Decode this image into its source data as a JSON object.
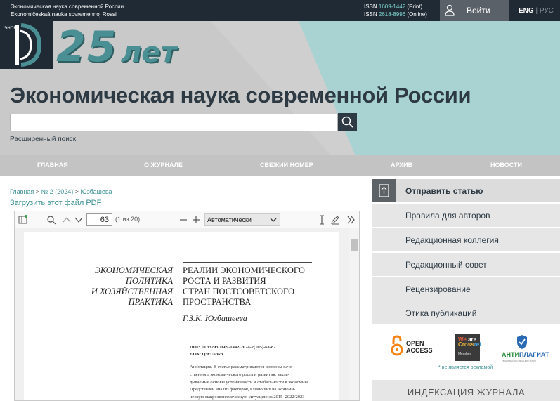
{
  "topbar": {
    "journal_ru": "Экономическая наука современной России",
    "journal_lat": "Ekonomičeskaâ nauka sovremennoj Rossii",
    "issn_print_label": "ISSN",
    "issn_print": "1609-1442",
    "issn_print_suffix": "(Print)",
    "issn_online_label": "ISSN",
    "issn_online": "2618-8996",
    "issn_online_suffix": "(Online)",
    "login_label": "Войти",
    "lang_eng": "ENG",
    "lang_sep": "|",
    "lang_rus": "РУС"
  },
  "hero": {
    "anniversary_number": "25",
    "anniversary_word": "лет",
    "title": "Экономическая наука современной России",
    "search_placeholder": "",
    "advanced_search": "Расширенный поиск",
    "colors": {
      "teal": "#a8d3d2",
      "gray": "#c9c9c9",
      "dark": "#1f2a34"
    }
  },
  "nav": {
    "items": [
      "Главная",
      "О журнале",
      "Свежий номер",
      "Архив",
      "Новости"
    ]
  },
  "breadcrumb": {
    "home": "Главная",
    "sep1": ">",
    "issue": "№ 2 (2024)",
    "sep2": ">",
    "current": "Юзбашева"
  },
  "download_link": "Загрузить этот файл PDF",
  "pdf_viewer": {
    "page_number": "63",
    "page_of": "(1 из 20)",
    "zoom": "Автоматически",
    "document": {
      "section": [
        "ЭКОНОМИЧЕСКАЯ",
        "ПОЛИТИКА",
        "И ХОЗЯЙСТВЕННАЯ",
        "ПРАКТИКА"
      ],
      "title": [
        "РЕАЛИИ ЭКОНОМИЧЕСКОГО",
        "РОСТА И РАЗВИТИЯ",
        "СТРАН ПОСТСОВЕТСКОГО",
        "ПРОСТРАНСТВА"
      ],
      "author": "Г.З.К. Юзбашеева",
      "doi": "DOI: 10.33293/1609-1442-2024-2(105)-63-82",
      "edn": "EDN: QWUFWY",
      "abstract_lines": [
        "Аннотация. В статье рассматриваются вопросы каче-",
        "ственного экономического роста и развития, закла-",
        "дываемые основы устойчивости и стабильности в экономике.",
        "Представлен анализ факторов, влияющих на экономи-",
        "ческую макроэкономическую ситуацию за 2015–2022/2023"
      ]
    }
  },
  "sidebar": {
    "items": [
      "Отправить статью",
      "Правила для авторов",
      "Редакционная коллегия",
      "Редакционный совет",
      "Рецензирование",
      "Этика публикаций"
    ],
    "logos": {
      "open_access": [
        "OPEN",
        "ACCESS"
      ],
      "crossref_top": [
        "We",
        "are",
        "Cross",
        "ref"
      ],
      "crossref_member": "Member",
      "antiplagiat_a": "АНТИ",
      "antiplagiat_b": "ПЛАГИАТ",
      "antiplagiat_sub": "ТВОРИТЕ СОБСТВЕННЫМ УМОМ",
      "ad_note": "* не является рекламой"
    },
    "indexing_title": "ИНДЕКСАЦИЯ ЖУРНАЛА"
  }
}
